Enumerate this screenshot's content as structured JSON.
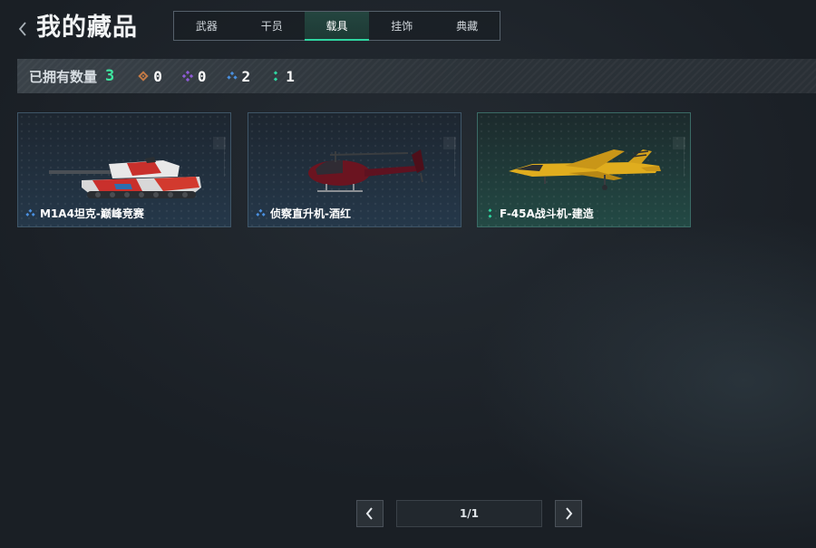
{
  "header": {
    "title": "我的藏品"
  },
  "tabs": [
    {
      "label": "武器",
      "active": false
    },
    {
      "label": "干员",
      "active": false
    },
    {
      "label": "载具",
      "active": true
    },
    {
      "label": "挂饰",
      "active": false
    },
    {
      "label": "典藏",
      "active": false
    }
  ],
  "summary": {
    "label": "已拥有数量",
    "total": "3",
    "rarities": [
      {
        "icon": "orange-rarity-icon",
        "color": "#c47a45",
        "count": "0"
      },
      {
        "icon": "purple-rarity-icon",
        "color": "#8f5bd8",
        "count": "0"
      },
      {
        "icon": "blue-rarity-icon",
        "color": "#4a90e0",
        "count": "2"
      },
      {
        "icon": "green-rarity-icon",
        "color": "#2fd6a1",
        "count": "1"
      }
    ]
  },
  "items": [
    {
      "name": "M1A4坦克-巅峰竞赛",
      "rarity": "blue",
      "icon": "tank-image"
    },
    {
      "name": "侦察直升机-酒红",
      "rarity": "blue",
      "icon": "helicopter-image"
    },
    {
      "name": "F-45A战斗机-建造",
      "rarity": "green",
      "icon": "fighter-jet-image"
    }
  ],
  "pagination": {
    "indicator": "1/1"
  },
  "colors": {
    "accent": "#2fd6a1",
    "total_count": "#3ee6a0"
  }
}
